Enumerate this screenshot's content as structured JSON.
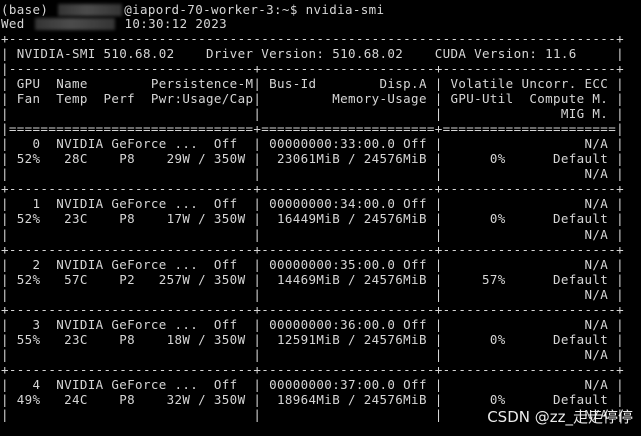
{
  "prompt": {
    "env": "(base)",
    "host_suffix": "@iapord-70-worker-3:~$ nvidia-smi"
  },
  "date_line": {
    "day": "Wed",
    "time_year": "10:30:12 2023"
  },
  "smi_lines": [
    "+-----------------------------------------------------------------------------+",
    "| NVIDIA-SMI 510.68.02    Driver Version: 510.68.02    CUDA Version: 11.6     |",
    "|-------------------------------+----------------------+----------------------+",
    "| GPU  Name        Persistence-M| Bus-Id        Disp.A | Volatile Uncorr. ECC |",
    "| Fan  Temp  Perf  Pwr:Usage/Cap|         Memory-Usage | GPU-Util  Compute M. |",
    "|                               |                      |               MIG M. |",
    "|===============================+======================+======================|",
    "|   0  NVIDIA GeForce ...  Off  | 00000000:33:00.0 Off |                  N/A |",
    "| 52%   28C    P8    29W / 350W |  23061MiB / 24576MiB |      0%      Default |",
    "|                               |                      |                  N/A |",
    "+-------------------------------+----------------------+----------------------+",
    "|   1  NVIDIA GeForce ...  Off  | 00000000:34:00.0 Off |                  N/A |",
    "| 52%   23C    P8    17W / 350W |  16449MiB / 24576MiB |      0%      Default |",
    "|                               |                      |                  N/A |",
    "+-------------------------------+----------------------+----------------------+",
    "|   2  NVIDIA GeForce ...  Off  | 00000000:35:00.0 Off |                  N/A |",
    "| 52%   57C    P2   257W / 350W |  14469MiB / 24576MiB |     57%      Default |",
    "|                               |                      |                  N/A |",
    "+-------------------------------+----------------------+----------------------+",
    "|   3  NVIDIA GeForce ...  Off  | 00000000:36:00.0 Off |                  N/A |",
    "| 55%   23C    P8    18W / 350W |  12591MiB / 24576MiB |      0%      Default |",
    "|                               |                      |                  N/A |",
    "+-------------------------------+----------------------+----------------------+",
    "|   4  NVIDIA GeForce ...  Off  | 00000000:37:00.0 Off |                  N/A |",
    "| 49%   24C    P8    32W / 350W |  18964MiB / 24576MiB |      0%      Default |",
    "|                               |                      |                  N/A |"
  ],
  "watermark": "CSDN @zz_走走停停"
}
